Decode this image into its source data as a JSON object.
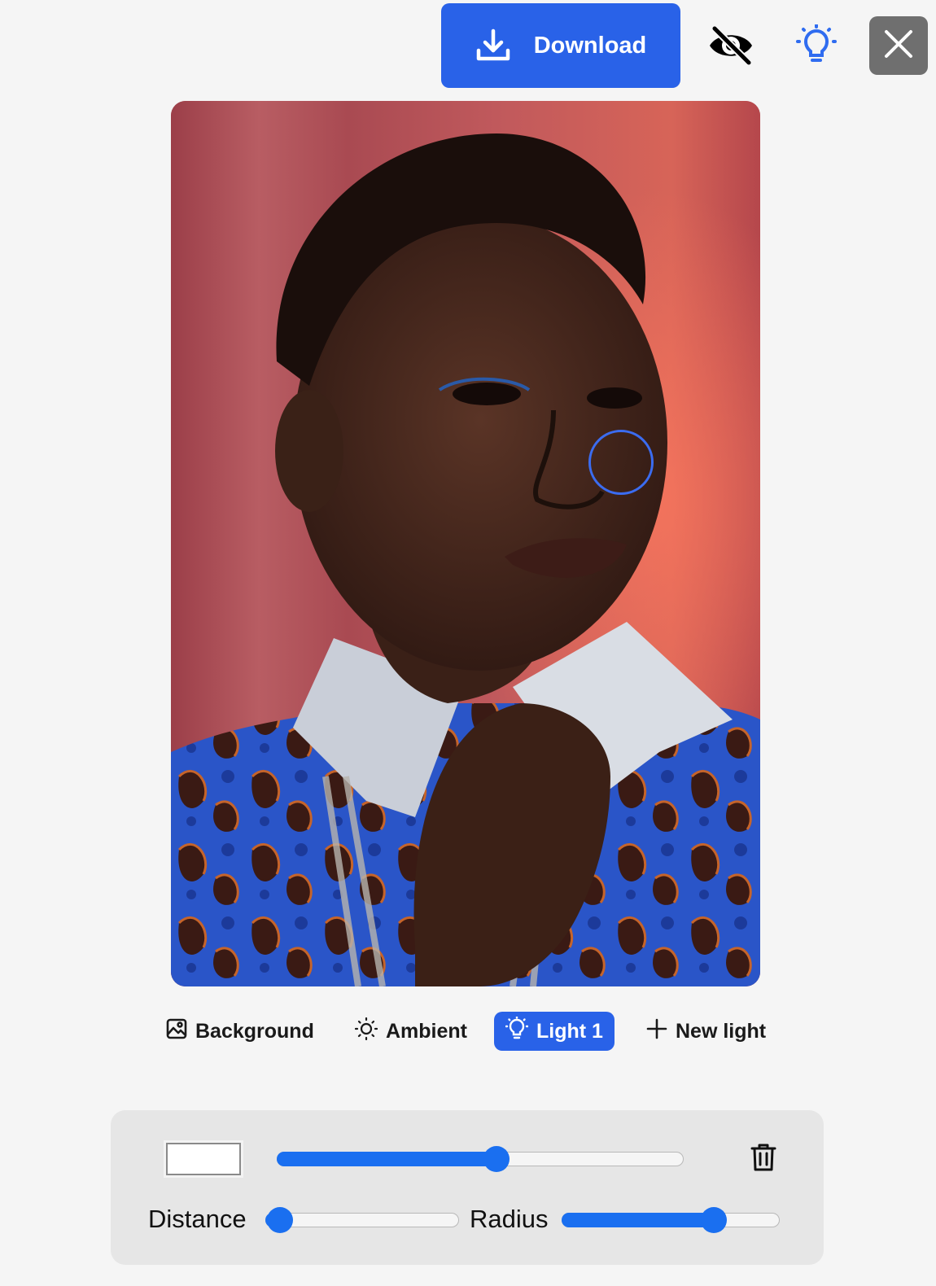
{
  "toolbar": {
    "download_label": "Download",
    "download_icon": "download-icon",
    "hide_icon": "eye-off-icon",
    "light_icon": "lightbulb-icon",
    "close_icon": "close-icon",
    "accent_color": "#2962e8"
  },
  "canvas": {
    "image_description_icon": "portrait-photo",
    "light_handle_color": "#3b6cf0"
  },
  "tabs": [
    {
      "label": "Background",
      "icon": "image-icon",
      "active": false
    },
    {
      "label": "Ambient",
      "icon": "sun-icon",
      "active": false
    },
    {
      "label": "Light 1",
      "icon": "lightbulb-icon",
      "active": true
    },
    {
      "label": "New light",
      "icon": "plus-icon",
      "active": false
    }
  ],
  "panel": {
    "color_value": "#ffffff",
    "intensity_value": 0.54,
    "distance_label": "Distance",
    "distance_value": 0.07,
    "radius_label": "Radius",
    "radius_value": 0.7,
    "delete_icon": "trash-icon",
    "slider_color": "#1a6ff0"
  }
}
